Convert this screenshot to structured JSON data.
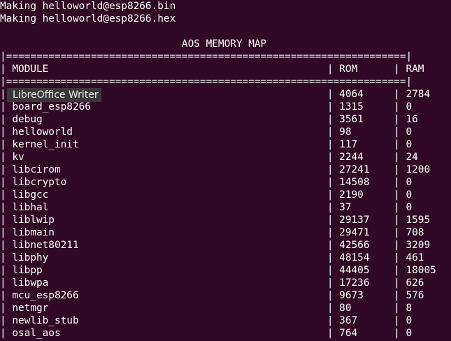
{
  "make_lines": [
    "Making helloworld@esp8266.bin",
    "Making helloworld@esp8266.hex"
  ],
  "map_title": "AOS MEMORY MAP",
  "table": {
    "headers": {
      "module": "MODULE",
      "rom": "ROM",
      "ram": "RAM"
    },
    "rows": [
      {
        "module": "",
        "rom": "4064",
        "ram": "2784"
      },
      {
        "module": "board_esp8266",
        "rom": "1315",
        "ram": "0"
      },
      {
        "module": "debug",
        "rom": "3561",
        "ram": "16"
      },
      {
        "module": "helloworld",
        "rom": "98",
        "ram": "0"
      },
      {
        "module": "kernel_init",
        "rom": "117",
        "ram": "0"
      },
      {
        "module": "kv",
        "rom": "2244",
        "ram": "24"
      },
      {
        "module": "libcirom",
        "rom": "27241",
        "ram": "1200"
      },
      {
        "module": "libcrypto",
        "rom": "14508",
        "ram": "0"
      },
      {
        "module": "libgcc",
        "rom": "2190",
        "ram": "0"
      },
      {
        "module": "libhal",
        "rom": "37",
        "ram": "0"
      },
      {
        "module": "liblwip",
        "rom": "29137",
        "ram": "1595"
      },
      {
        "module": "libmain",
        "rom": "29471",
        "ram": "708"
      },
      {
        "module": "libnet80211",
        "rom": "42566",
        "ram": "3209"
      },
      {
        "module": "libphy",
        "rom": "48154",
        "ram": "461"
      },
      {
        "module": "libpp",
        "rom": "44405",
        "ram": "18005"
      },
      {
        "module": "libwpa",
        "rom": "17236",
        "ram": "626"
      },
      {
        "module": "mcu_esp8266",
        "rom": "9673",
        "ram": "576"
      },
      {
        "module": "netmgr",
        "rom": "80",
        "ram": "8"
      },
      {
        "module": "newlib_stub",
        "rom": "367",
        "ram": "0"
      },
      {
        "module": "osal_aos",
        "rom": "764",
        "ram": "0"
      }
    ]
  },
  "tooltip": "LibreOffice Writer",
  "colors": {
    "background": "#300a24",
    "foreground": "#ffffff",
    "tooltip_background": "#3b3b3b"
  }
}
